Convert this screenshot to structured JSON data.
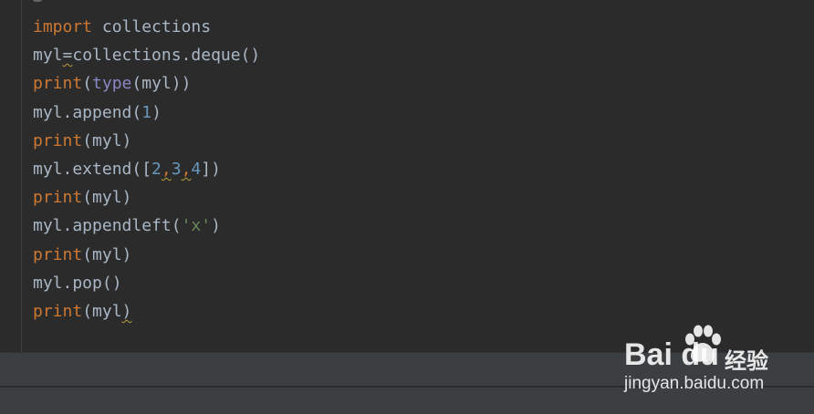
{
  "editor": {
    "lines": [
      [
        {
          "t": "import",
          "c": "kw"
        },
        {
          "t": " collections",
          "c": "txt"
        }
      ],
      [
        {
          "t": "myl",
          "c": "txt"
        },
        {
          "t": "=",
          "c": "txt",
          "w": true
        },
        {
          "t": "collections.deque()",
          "c": "txt"
        }
      ],
      [
        {
          "t": "print",
          "c": "kw"
        },
        {
          "t": "(",
          "c": "txt"
        },
        {
          "t": "type",
          "c": "bi"
        },
        {
          "t": "(myl))",
          "c": "txt"
        }
      ],
      [
        {
          "t": "myl.append(",
          "c": "txt"
        },
        {
          "t": "1",
          "c": "num"
        },
        {
          "t": ")",
          "c": "txt"
        }
      ],
      [
        {
          "t": "print",
          "c": "kw"
        },
        {
          "t": "(myl)",
          "c": "txt"
        }
      ],
      [
        {
          "t": "myl.extend([",
          "c": "txt"
        },
        {
          "t": "2",
          "c": "num"
        },
        {
          "t": ",",
          "c": "kw",
          "w": true
        },
        {
          "t": "3",
          "c": "num"
        },
        {
          "t": ",",
          "c": "kw",
          "w": true
        },
        {
          "t": "4",
          "c": "num"
        },
        {
          "t": "])",
          "c": "txt"
        }
      ],
      [
        {
          "t": "print",
          "c": "kw"
        },
        {
          "t": "(myl)",
          "c": "txt"
        }
      ],
      [
        {
          "t": "myl.appendleft(",
          "c": "txt"
        },
        {
          "t": "'x'",
          "c": "str"
        },
        {
          "t": ")",
          "c": "txt"
        }
      ],
      [
        {
          "t": "print",
          "c": "kw"
        },
        {
          "t": "(myl)",
          "c": "txt"
        }
      ],
      [
        {
          "t": "myl.pop()",
          "c": "txt"
        }
      ],
      [
        {
          "t": "print",
          "c": "kw"
        },
        {
          "t": "(myl",
          "c": "txt"
        },
        {
          "t": ")",
          "c": "txt",
          "w": true
        }
      ]
    ]
  },
  "watermark": {
    "brand": "Bai  du",
    "sub": "经验",
    "url": "jingyan.baidu.com",
    "paw_icon": "baidu-paw-icon"
  },
  "colors": {
    "background": "#2b2b2b",
    "keyword": "#cc7832",
    "builtin": "#8888c6",
    "number": "#6897bb",
    "string": "#6a8759",
    "text": "#a9b7c6",
    "panel": "#3c3f41"
  }
}
